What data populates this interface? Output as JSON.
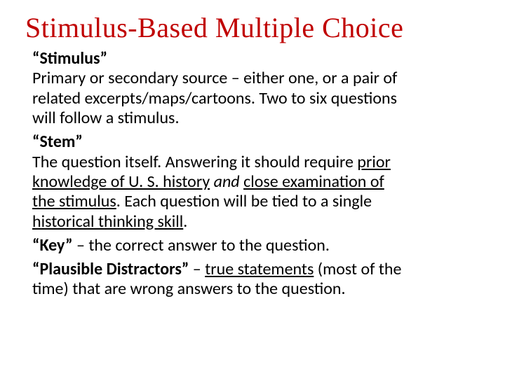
{
  "title": "Stimulus-Based Multiple Choice",
  "stimulus": {
    "term": "“Stimulus”",
    "line1a": "Primary or secondary source – either one, or a pair of ",
    "line2a": "related excerpts/maps/cartoons. Two to six questions ",
    "line3a": "will follow a stimulus."
  },
  "stem": {
    "term": "“Stem”",
    "l1": "The question itself. Answering it should require ",
    "l1u": "prior ",
    "l2u": "knowledge of U. S. history",
    "l2mid": " ",
    "l2and": "and",
    "l2mid2": " ",
    "l2u2": "close examination of ",
    "l3u": "the stimulus",
    "l3a": ". Each question will be tied to a single ",
    "l4u": "historical thinking skill",
    "l4a": "."
  },
  "key": {
    "term": "“Key”",
    "rest": " – the correct answer to the question."
  },
  "pd": {
    "term": "“Plausible Distractors”",
    "a": " – ",
    "u": "true statements",
    "b": " (most of the ",
    "c": "time) that are wrong answers to the question."
  }
}
